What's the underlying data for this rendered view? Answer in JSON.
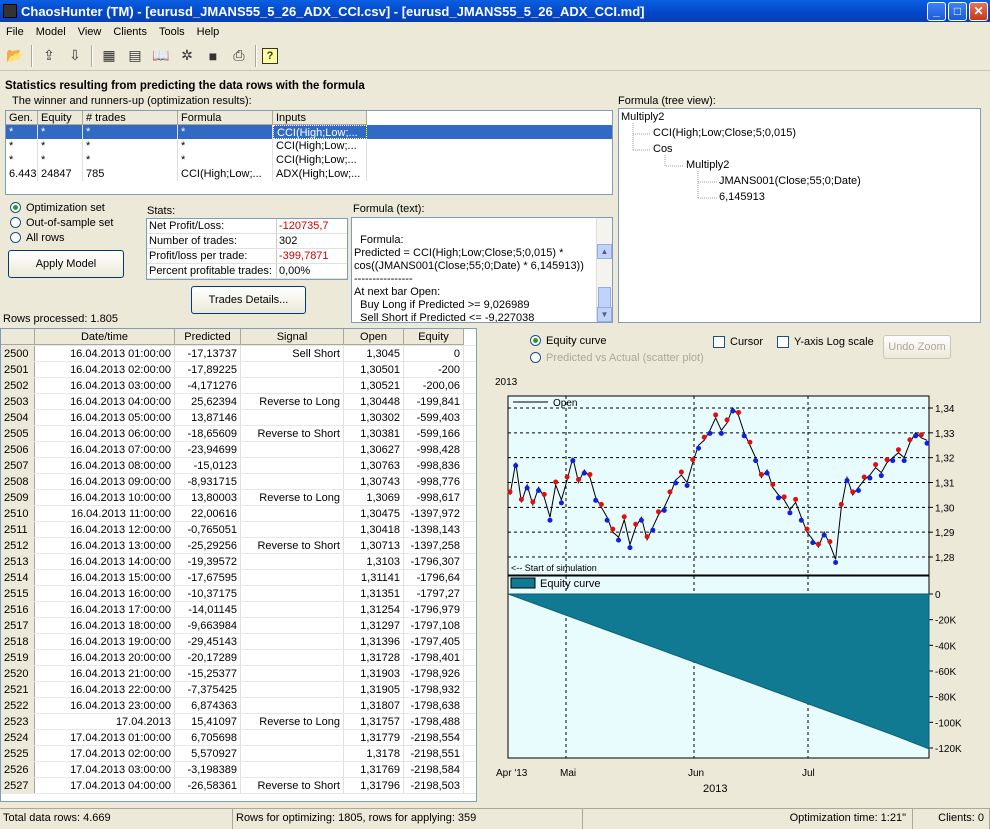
{
  "window": {
    "title": "ChaosHunter (TM) - [eurusd_JMANS55_5_26_ADX_CCI.csv] - [eurusd_JMANS55_5_26_ADX_CCI.md]"
  },
  "menu": [
    "File",
    "Model",
    "View",
    "Clients",
    "Tools",
    "Help"
  ],
  "toolbar_icons": [
    "open-folder-icon",
    "export-icon",
    "import-icon",
    "table-icon",
    "chart-icon",
    "book-icon",
    "network-icon",
    "save-icon",
    "print-icon",
    "help-icon"
  ],
  "heading": "Statistics resulting from predicting the data rows with the formula",
  "winners": {
    "label": "The winner and runners-up (optimization results):",
    "columns": [
      "Gen.",
      "Equity",
      "# trades",
      "Formula",
      "Inputs"
    ],
    "rows": [
      [
        "*",
        "*",
        "*",
        "*",
        "CCI(High;Low;..."
      ],
      [
        "*",
        "*",
        "*",
        "*",
        "CCI(High;Low;..."
      ],
      [
        "*",
        "*",
        "*",
        "*",
        "CCI(High;Low;..."
      ],
      [
        "6.443",
        "24847",
        "785",
        "CCI(High;Low;...",
        "ADX(High;Low;..."
      ]
    ]
  },
  "tree": {
    "label": "Formula (tree view):",
    "nodes": [
      "Multiply2",
      "CCI(High;Low;Close;5;0,015)",
      "Cos",
      "Multiply2",
      "JMANS001(Close;55;0;Date)",
      "6,145913"
    ]
  },
  "sets": {
    "options": [
      "Optimization set",
      "Out-of-sample set",
      "All rows"
    ],
    "apply": "Apply Model"
  },
  "stats": {
    "label": "Stats:",
    "rows": [
      [
        "Net Profit/Loss:",
        "-120735,7"
      ],
      [
        "Number of trades:",
        "302"
      ],
      [
        "Profit/loss per trade:",
        "-399,7871"
      ],
      [
        "Percent profitable trades:",
        "0,00%"
      ]
    ],
    "trades_button": "Trades Details..."
  },
  "formula_text": {
    "label": "Formula (text):",
    "text": "Formula:\nPredicted = CCI(High;Low;Close;5;0,015) *\ncos((JMANS001(Close;55;0;Date) * 6,145913))\n----------------\nAt next bar Open:\n  Buy Long if Predicted >= 9,026989\n  Sell Short if Predicted <= -9,227038"
  },
  "rows_processed": "Rows processed: 1.805",
  "grid": {
    "columns": [
      "",
      "Date/time",
      "Predicted",
      "Signal",
      "Open",
      "Equity"
    ],
    "rows": [
      [
        "2500",
        "16.04.2013 01:00:00",
        "-17,13737",
        "Sell Short",
        "1,3045",
        "0"
      ],
      [
        "2501",
        "16.04.2013 02:00:00",
        "-17,89225",
        "",
        "1,30501",
        "-200"
      ],
      [
        "2502",
        "16.04.2013 03:00:00",
        "-4,171276",
        "",
        "1,30521",
        "-200,06"
      ],
      [
        "2503",
        "16.04.2013 04:00:00",
        "25,62394",
        "Reverse to Long",
        "1,30448",
        "-199,841"
      ],
      [
        "2504",
        "16.04.2013 05:00:00",
        "13,87146",
        "",
        "1,30302",
        "-599,403"
      ],
      [
        "2505",
        "16.04.2013 06:00:00",
        "-18,65609",
        "Reverse to Short",
        "1,30381",
        "-599,166"
      ],
      [
        "2506",
        "16.04.2013 07:00:00",
        "-23,94699",
        "",
        "1,30627",
        "-998,428"
      ],
      [
        "2507",
        "16.04.2013 08:00:00",
        "-15,0123",
        "",
        "1,30763",
        "-998,836"
      ],
      [
        "2508",
        "16.04.2013 09:00:00",
        "-8,931715",
        "",
        "1,30743",
        "-998,776"
      ],
      [
        "2509",
        "16.04.2013 10:00:00",
        "13,80003",
        "Reverse to Long",
        "1,3069",
        "-998,617"
      ],
      [
        "2510",
        "16.04.2013 11:00:00",
        "22,00616",
        "",
        "1,30475",
        "-1397,972"
      ],
      [
        "2511",
        "16.04.2013 12:00:00",
        "-0,765051",
        "",
        "1,30418",
        "-1398,143"
      ],
      [
        "2512",
        "16.04.2013 13:00:00",
        "-25,29256",
        "Reverse to Short",
        "1,30713",
        "-1397,258"
      ],
      [
        "2513",
        "16.04.2013 14:00:00",
        "-19,39572",
        "",
        "1,3103",
        "-1796,307"
      ],
      [
        "2514",
        "16.04.2013 15:00:00",
        "-17,67595",
        "",
        "1,31141",
        "-1796,64"
      ],
      [
        "2515",
        "16.04.2013 16:00:00",
        "-10,37175",
        "",
        "1,31351",
        "-1797,27"
      ],
      [
        "2516",
        "16.04.2013 17:00:00",
        "-14,01145",
        "",
        "1,31254",
        "-1796,979"
      ],
      [
        "2517",
        "16.04.2013 18:00:00",
        "-9,663984",
        "",
        "1,31297",
        "-1797,108"
      ],
      [
        "2518",
        "16.04.2013 19:00:00",
        "-29,45143",
        "",
        "1,31396",
        "-1797,405"
      ],
      [
        "2519",
        "16.04.2013 20:00:00",
        "-20,17289",
        "",
        "1,31728",
        "-1798,401"
      ],
      [
        "2520",
        "16.04.2013 21:00:00",
        "-15,25377",
        "",
        "1,31903",
        "-1798,926"
      ],
      [
        "2521",
        "16.04.2013 22:00:00",
        "-7,375425",
        "",
        "1,31905",
        "-1798,932"
      ],
      [
        "2522",
        "16.04.2013 23:00:00",
        "6,874363",
        "",
        "1,31807",
        "-1798,638"
      ],
      [
        "2523",
        "17.04.2013",
        "15,41097",
        "Reverse to Long",
        "1,31757",
        "-1798,488"
      ],
      [
        "2524",
        "17.04.2013 01:00:00",
        "6,705698",
        "",
        "1,31779",
        "-2198,554"
      ],
      [
        "2525",
        "17.04.2013 02:00:00",
        "5,570927",
        "",
        "1,3178",
        "-2198,551"
      ],
      [
        "2526",
        "17.04.2013 03:00:00",
        "-3,198389",
        "",
        "1,31769",
        "-2198,584"
      ],
      [
        "2527",
        "17.04.2013 04:00:00",
        "-26,58361",
        "Reverse to Short",
        "1,31796",
        "-2198,503"
      ]
    ]
  },
  "chart_panel": {
    "equity_curve": "Equity curve",
    "scatter": "Predicted vs Actual (scatter plot)",
    "cursor": "Cursor",
    "log": "Y-axis Log scale",
    "undo": "Undo Zoom"
  },
  "chart_data": {
    "type": "line",
    "year_label": "2013",
    "xlabel": "2013",
    "x_ticks": [
      "Apr '13",
      "Mai",
      "Jun",
      "Jul"
    ],
    "top_panel": {
      "legend": "Open",
      "y_ticks": [
        "1,34",
        "1,33",
        "1,32",
        "1,31",
        "1,30",
        "1,29",
        "1,28"
      ],
      "ylim": [
        1.275,
        1.345
      ],
      "annotation": "<-- Start of simulation",
      "values": [
        1.305,
        1.318,
        1.302,
        1.309,
        1.301,
        1.308,
        1.304,
        1.296,
        1.309,
        1.303,
        1.311,
        1.32,
        1.31,
        1.315,
        1.312,
        1.304,
        1.3,
        1.296,
        1.29,
        1.288,
        1.295,
        1.285,
        1.292,
        1.296,
        1.287,
        1.292,
        1.297,
        1.3,
        1.305,
        1.311,
        1.313,
        1.31,
        1.318,
        1.325,
        1.327,
        1.331,
        1.336,
        1.331,
        1.334,
        1.34,
        1.337,
        1.33,
        1.325,
        1.32,
        1.312,
        1.315,
        1.308,
        1.305,
        1.303,
        1.299,
        1.302,
        1.296,
        1.29,
        1.287,
        1.284,
        1.29,
        1.285,
        1.279,
        1.3,
        1.312,
        1.305,
        1.308,
        1.311,
        1.313,
        1.316,
        1.314,
        1.318,
        1.32,
        1.322,
        1.32,
        1.326,
        1.33,
        1.328,
        1.327
      ]
    },
    "bottom_panel": {
      "legend": "Equity curve",
      "y_ticks": [
        "0",
        "-20K",
        "-40K",
        "-60K",
        "-80K",
        "-100K",
        "-120K"
      ],
      "ylim": [
        -125000,
        0
      ],
      "values": [
        0,
        -10000,
        -20000,
        -30000,
        -40000,
        -50000,
        -60000,
        -70000,
        -80000,
        -90000,
        -100000,
        -110000,
        -120735
      ]
    }
  },
  "status": {
    "total": "Total data rows: 4.669",
    "split": "Rows for optimizing: 1805, rows for applying: 359",
    "time": "Optimization time: 1:21\"",
    "clients": "Clients: 0"
  }
}
